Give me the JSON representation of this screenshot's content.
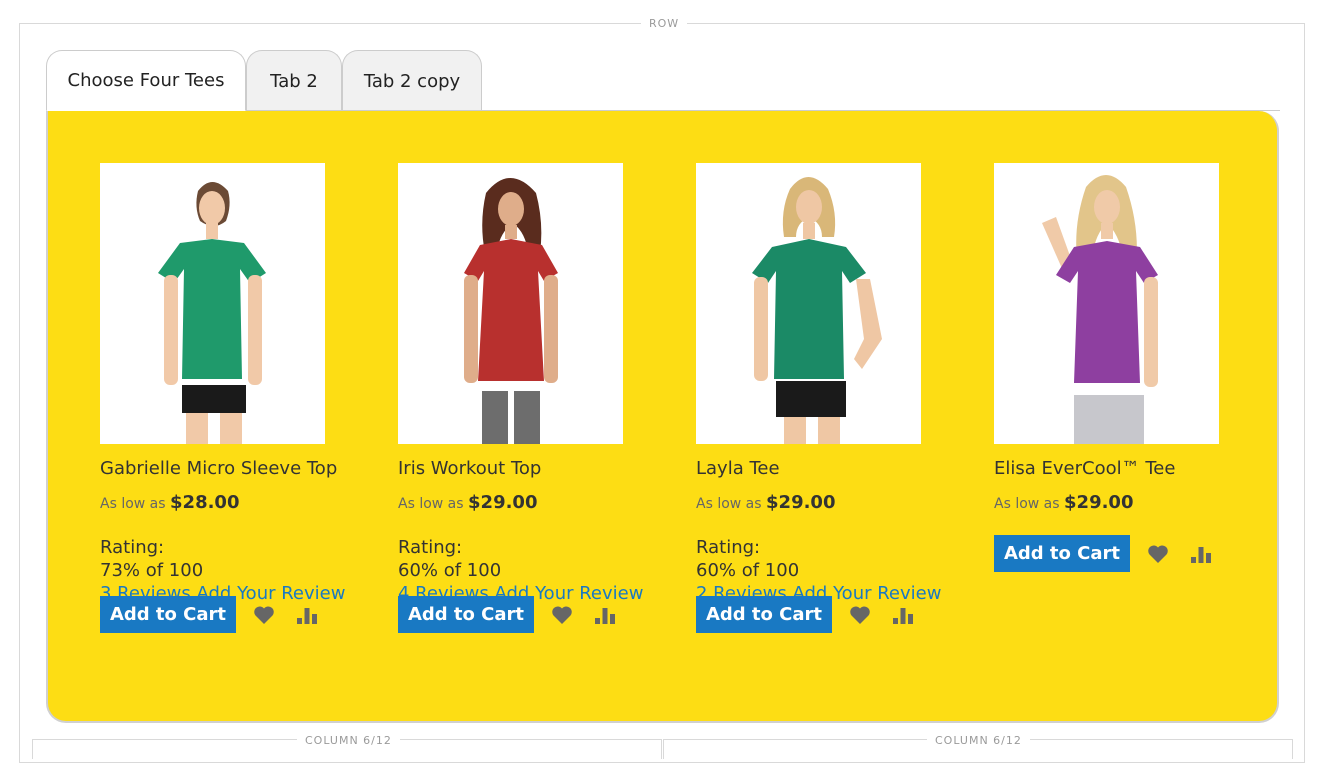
{
  "layout_labels": {
    "row": "ROW",
    "column_left": "COLUMN 6/12",
    "column_right": "COLUMN 6/12"
  },
  "tabs": [
    {
      "label": "Choose Four Tees",
      "active": true
    },
    {
      "label": "Tab 2",
      "active": false
    },
    {
      "label": "Tab 2 copy",
      "active": false
    }
  ],
  "panel": {
    "background_color": "#fddd14"
  },
  "products": [
    {
      "name": "Gabrielle Micro Sleeve Top",
      "price_prefix": "As low as",
      "price": "$28.00",
      "rating_label": "Rating:",
      "rating_value": "73% of 100",
      "reviews_text": "3 Reviews",
      "add_review_text": "Add Your Review",
      "add_to_cart": "Add to Cart",
      "shirt_color": "#1f9a6b"
    },
    {
      "name": "Iris Workout Top",
      "price_prefix": "As low as",
      "price": "$29.00",
      "rating_label": "Rating:",
      "rating_value": "60% of 100",
      "reviews_text": "4 Reviews",
      "add_review_text": "Add Your Review",
      "add_to_cart": "Add to Cart",
      "shirt_color": "#b8302e"
    },
    {
      "name": "Layla Tee",
      "price_prefix": "As low as",
      "price": "$29.00",
      "rating_label": "Rating:",
      "rating_value": "60% of 100",
      "reviews_text": "2 Reviews",
      "add_review_text": "Add Your Review",
      "add_to_cart": "Add to Cart",
      "shirt_color": "#1b8a66"
    },
    {
      "name": "Elisa EverCool™ Tee",
      "price_prefix": "As low as",
      "price": "$29.00",
      "add_to_cart": "Add to Cart",
      "shirt_color": "#8e3fa0"
    }
  ],
  "icons": {
    "wishlist": "heart-icon",
    "compare": "bar-chart-icon"
  },
  "colors": {
    "accent_blue": "#1979c3",
    "icon_gray": "#666666"
  }
}
